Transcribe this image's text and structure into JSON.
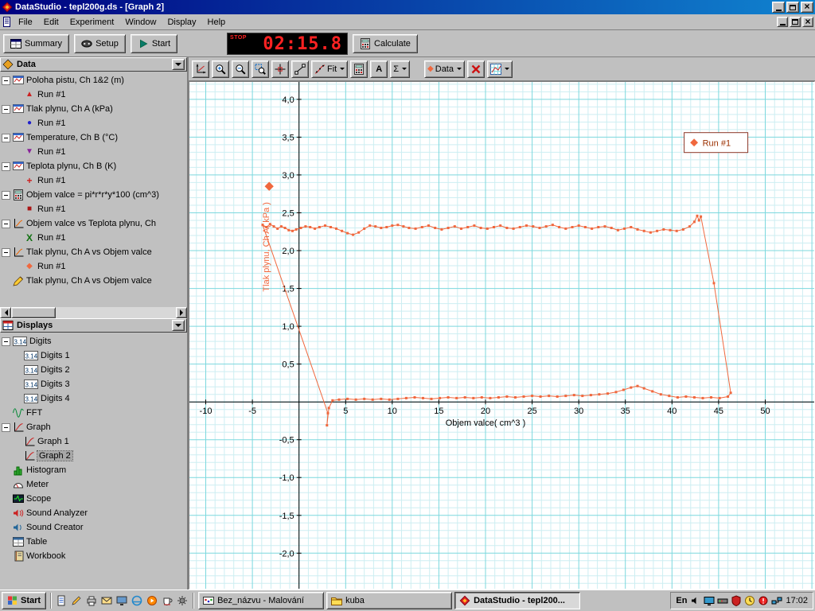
{
  "titlebar": {
    "title": "DataStudio - tepl200g.ds - [Graph 2]"
  },
  "menubar": {
    "items": [
      "File",
      "Edit",
      "Experiment",
      "Window",
      "Display",
      "Help"
    ]
  },
  "toolbar": {
    "summary_label": "Summary",
    "setup_label": "Setup",
    "start_label": "Start",
    "timer_mode": "STOP",
    "timer_value": "02:15.8",
    "calculate_label": "Calculate"
  },
  "graph_toolbar": {
    "buttons": [
      {
        "name": "scale-to-fit"
      },
      {
        "name": "zoom-in"
      },
      {
        "name": "zoom-out"
      },
      {
        "name": "zoom-select"
      },
      {
        "name": "smart-tool"
      },
      {
        "name": "slope-tool"
      },
      {
        "name": "fit",
        "label": "Fit",
        "dropdown": true,
        "icon": "fit-mini"
      },
      {
        "name": "calculator"
      },
      {
        "name": "text-annotation",
        "label": "A"
      },
      {
        "name": "statistics",
        "label": "Σ",
        "dropdown": true
      },
      {
        "name": "gap"
      },
      {
        "name": "data-select",
        "label": "Data",
        "dropdown": true,
        "icon": "diamond"
      },
      {
        "name": "delete-data"
      },
      {
        "name": "graph-options",
        "dropdown": true
      }
    ]
  },
  "sidebar": {
    "data_header": "Data",
    "displays_header": "Displays",
    "data_items": [
      {
        "label": "Poloha pistu, Ch 1&2 (m)",
        "icon": "sensor",
        "runs": [
          {
            "label": "Run #1",
            "marker": "triangle-red"
          }
        ]
      },
      {
        "label": "Tlak plynu, Ch A (kPa)",
        "icon": "sensor",
        "runs": [
          {
            "label": "Run #1",
            "marker": "circle-blue"
          }
        ]
      },
      {
        "label": "Temperature, Ch B (°C)",
        "icon": "sensor",
        "runs": [
          {
            "label": "Run #1",
            "marker": "triangle-purple"
          }
        ]
      },
      {
        "label": "Teplota plynu, Ch B (K)",
        "icon": "sensor",
        "runs": [
          {
            "label": "Run #1",
            "marker": "plus-red"
          }
        ]
      },
      {
        "label": "Objem valce = pi*r*r*y*100 (cm^3)",
        "icon": "calc",
        "runs": [
          {
            "label": "Run #1",
            "marker": "square-red"
          }
        ]
      },
      {
        "label": "Objem valce vs Teplota plynu, Ch",
        "icon": "graphxy",
        "runs": [
          {
            "label": "Run #1",
            "marker": "x-green"
          }
        ]
      },
      {
        "label": "Tlak plynu, Ch A vs Objem valce",
        "icon": "graphxy",
        "runs": [
          {
            "label": "Run #1",
            "marker": "diamond-orange"
          }
        ]
      },
      {
        "label": "Tlak plynu, Ch A vs Objem valce",
        "icon": "pen",
        "runs": []
      }
    ],
    "display_items": [
      {
        "label": "Digits",
        "icon": "digits",
        "expandable": true
      },
      {
        "label": "Digits 1",
        "icon": "digits",
        "child": true
      },
      {
        "label": "Digits 2",
        "icon": "digits",
        "child": true
      },
      {
        "label": "Digits 3",
        "icon": "digits",
        "child": true
      },
      {
        "label": "Digits 4",
        "icon": "digits",
        "child": true
      },
      {
        "label": "FFT",
        "icon": "fft"
      },
      {
        "label": "Graph",
        "icon": "graph-display",
        "expandable": true
      },
      {
        "label": "Graph 1",
        "icon": "graph-display",
        "child": true
      },
      {
        "label": "Graph 2",
        "icon": "graph-display",
        "child": true,
        "selected": true
      },
      {
        "label": "Histogram",
        "icon": "histogram"
      },
      {
        "label": "Meter",
        "icon": "meter"
      },
      {
        "label": "Scope",
        "icon": "scope"
      },
      {
        "label": "Sound Analyzer",
        "icon": "sound-analyzer"
      },
      {
        "label": "Sound Creator",
        "icon": "sound-creator"
      },
      {
        "label": "Table",
        "icon": "table"
      },
      {
        "label": "Workbook",
        "icon": "workbook"
      }
    ],
    "markers": {
      "triangle-red": {
        "glyph": "▲",
        "color": "#cc2020"
      },
      "circle-blue": {
        "glyph": "●",
        "color": "#2020cc"
      },
      "triangle-purple": {
        "glyph": "▼",
        "color": "#882299"
      },
      "plus-red": {
        "glyph": "+",
        "color": "#cc2020",
        "bold": true
      },
      "square-red": {
        "glyph": "■",
        "color": "#aa1515"
      },
      "x-green": {
        "glyph": "X",
        "color": "#107010",
        "bold": true
      },
      "diamond-orange": {
        "glyph": "◆",
        "color": "#f0683e"
      }
    }
  },
  "chart_data": {
    "type": "scatter",
    "xlabel": "Objem valce( cm^3 )",
    "ylabel": "Tlak plynu, Ch A( kPa )",
    "legend": "Run #1",
    "xlim": [
      -11.75,
      55.25
    ],
    "ylim": [
      -2.47,
      4.23
    ],
    "x_major": 5,
    "x_minor": 1,
    "y_major": 0.5,
    "y_minor": 0.1,
    "grid_minor": "#cdeef2",
    "grid_major": "#7cd8de",
    "series_color": "#f0683e",
    "legend_border": "#8b3626",
    "legend_text_color": "#9c3000",
    "x_ticks": [
      {
        "v": -10,
        "label": "-10"
      },
      {
        "v": -5,
        "label": "-5"
      },
      {
        "v": 5,
        "label": "5"
      },
      {
        "v": 10,
        "label": "10"
      },
      {
        "v": 15,
        "label": "15"
      },
      {
        "v": 20,
        "label": "20"
      },
      {
        "v": 25,
        "label": "25"
      },
      {
        "v": 30,
        "label": "30"
      },
      {
        "v": 35,
        "label": "35"
      },
      {
        "v": 40,
        "label": "40"
      },
      {
        "v": 45,
        "label": "45"
      },
      {
        "v": 50,
        "label": "50"
      }
    ],
    "y_ticks": [
      {
        "v": 4.0,
        "label": "4,0"
      },
      {
        "v": 3.5,
        "label": "3,5"
      },
      {
        "v": 3.0,
        "label": "3,0"
      },
      {
        "v": 2.5,
        "label": "2,5"
      },
      {
        "v": 2.0,
        "label": "2,0"
      },
      {
        "v": 1.5,
        "label": "1,5"
      },
      {
        "v": 1.0,
        "label": "1,0"
      },
      {
        "v": 0.5,
        "label": "0,5"
      },
      {
        "v": -0.5,
        "label": "-0,5"
      },
      {
        "v": -1.0,
        "label": "-1,0"
      },
      {
        "v": -1.5,
        "label": "-1,5"
      },
      {
        "v": -2.0,
        "label": "-2,0"
      }
    ],
    "points": [
      [
        -3.9,
        2.34
      ],
      [
        -3.5,
        2.31
      ],
      [
        -3.1,
        2.35
      ],
      [
        -2.7,
        2.32
      ],
      [
        -2.3,
        2.29
      ],
      [
        -1.9,
        2.32
      ],
      [
        -1.5,
        2.3
      ],
      [
        -1.1,
        2.27
      ],
      [
        -0.7,
        2.26
      ],
      [
        -0.3,
        2.28
      ],
      [
        0.2,
        2.3
      ],
      [
        0.7,
        2.32
      ],
      [
        1.2,
        2.31
      ],
      [
        1.7,
        2.29
      ],
      [
        2.2,
        2.31
      ],
      [
        2.8,
        2.33
      ],
      [
        3.4,
        2.31
      ],
      [
        4.0,
        2.29
      ],
      [
        4.6,
        2.26
      ],
      [
        5.2,
        2.23
      ],
      [
        5.8,
        2.21
      ],
      [
        6.4,
        2.24
      ],
      [
        7.0,
        2.29
      ],
      [
        7.6,
        2.33
      ],
      [
        8.2,
        2.32
      ],
      [
        8.8,
        2.3
      ],
      [
        9.4,
        2.31
      ],
      [
        10.0,
        2.33
      ],
      [
        10.6,
        2.34
      ],
      [
        11.2,
        2.32
      ],
      [
        11.8,
        2.3
      ],
      [
        12.5,
        2.29
      ],
      [
        13.2,
        2.31
      ],
      [
        13.9,
        2.33
      ],
      [
        14.6,
        2.3
      ],
      [
        15.3,
        2.28
      ],
      [
        16.0,
        2.3
      ],
      [
        16.7,
        2.32
      ],
      [
        17.4,
        2.29
      ],
      [
        18.1,
        2.31
      ],
      [
        18.8,
        2.33
      ],
      [
        19.5,
        2.3
      ],
      [
        20.2,
        2.29
      ],
      [
        20.9,
        2.31
      ],
      [
        21.6,
        2.33
      ],
      [
        22.3,
        2.3
      ],
      [
        23.0,
        2.29
      ],
      [
        23.7,
        2.31
      ],
      [
        24.4,
        2.33
      ],
      [
        25.1,
        2.32
      ],
      [
        25.8,
        2.3
      ],
      [
        26.5,
        2.32
      ],
      [
        27.2,
        2.34
      ],
      [
        27.9,
        2.31
      ],
      [
        28.6,
        2.29
      ],
      [
        29.3,
        2.31
      ],
      [
        30.0,
        2.33
      ],
      [
        30.7,
        2.31
      ],
      [
        31.4,
        2.29
      ],
      [
        32.1,
        2.31
      ],
      [
        32.8,
        2.32
      ],
      [
        33.5,
        2.3
      ],
      [
        34.2,
        2.27
      ],
      [
        34.9,
        2.29
      ],
      [
        35.6,
        2.31
      ],
      [
        36.3,
        2.28
      ],
      [
        37.0,
        2.26
      ],
      [
        37.7,
        2.24
      ],
      [
        38.4,
        2.26
      ],
      [
        39.1,
        2.28
      ],
      [
        39.8,
        2.27
      ],
      [
        40.5,
        2.26
      ],
      [
        41.2,
        2.28
      ],
      [
        41.9,
        2.32
      ],
      [
        42.4,
        2.38
      ],
      [
        42.7,
        2.46
      ],
      [
        42.9,
        2.4
      ],
      [
        43.1,
        2.45
      ],
      [
        44.5,
        1.57
      ],
      [
        46.3,
        0.12
      ],
      [
        46.0,
        0.07
      ],
      [
        45.1,
        0.05
      ],
      [
        44.2,
        0.06
      ],
      [
        43.3,
        0.05
      ],
      [
        42.4,
        0.06
      ],
      [
        41.5,
        0.07
      ],
      [
        40.6,
        0.06
      ],
      [
        39.7,
        0.08
      ],
      [
        38.8,
        0.1
      ],
      [
        37.9,
        0.14
      ],
      [
        37.0,
        0.18
      ],
      [
        36.3,
        0.21
      ],
      [
        35.6,
        0.19
      ],
      [
        34.8,
        0.16
      ],
      [
        34.0,
        0.13
      ],
      [
        33.1,
        0.11
      ],
      [
        32.2,
        0.1
      ],
      [
        31.3,
        0.09
      ],
      [
        30.4,
        0.08
      ],
      [
        29.5,
        0.09
      ],
      [
        28.6,
        0.08
      ],
      [
        27.7,
        0.07
      ],
      [
        26.8,
        0.08
      ],
      [
        25.9,
        0.07
      ],
      [
        25.0,
        0.08
      ],
      [
        24.1,
        0.07
      ],
      [
        23.2,
        0.06
      ],
      [
        22.3,
        0.07
      ],
      [
        21.4,
        0.06
      ],
      [
        20.5,
        0.05
      ],
      [
        19.6,
        0.06
      ],
      [
        18.7,
        0.05
      ],
      [
        17.8,
        0.06
      ],
      [
        16.9,
        0.05
      ],
      [
        16.0,
        0.06
      ],
      [
        15.1,
        0.05
      ],
      [
        14.2,
        0.04
      ],
      [
        13.3,
        0.05
      ],
      [
        12.4,
        0.06
      ],
      [
        11.5,
        0.05
      ],
      [
        10.6,
        0.04
      ],
      [
        9.7,
        0.03
      ],
      [
        8.8,
        0.04
      ],
      [
        7.9,
        0.03
      ],
      [
        7.0,
        0.04
      ],
      [
        6.1,
        0.03
      ],
      [
        5.2,
        0.04
      ],
      [
        4.3,
        0.03
      ],
      [
        3.6,
        0.02
      ],
      [
        3.2,
        -0.08
      ],
      [
        3.0,
        -0.31
      ],
      [
        3.1,
        -0.15
      ],
      [
        -3.9,
        2.34
      ]
    ]
  },
  "taskbar": {
    "start_label": "Start",
    "quick_launch": [
      "notepad-icon",
      "paint-icon",
      "printer-icon",
      "mail-icon",
      "show-desktop-icon",
      "ie-icon",
      "media-player-icon",
      "java-icon",
      "settings-icon"
    ],
    "tasks": [
      {
        "label": "Bez_názvu - Malování",
        "icon": "paint-task",
        "active": false
      },
      {
        "label": "kuba",
        "icon": "folder",
        "active": false
      },
      {
        "label": "DataStudio - tepl200...",
        "icon": "ds-app",
        "active": true
      }
    ],
    "language": "En",
    "tray_icons": [
      "volume-icon",
      "display-icon",
      "modem-icon",
      "antivirus-icon",
      "scheduler-icon",
      "alert-icon",
      "network-icon"
    ],
    "clock": "17:02"
  }
}
